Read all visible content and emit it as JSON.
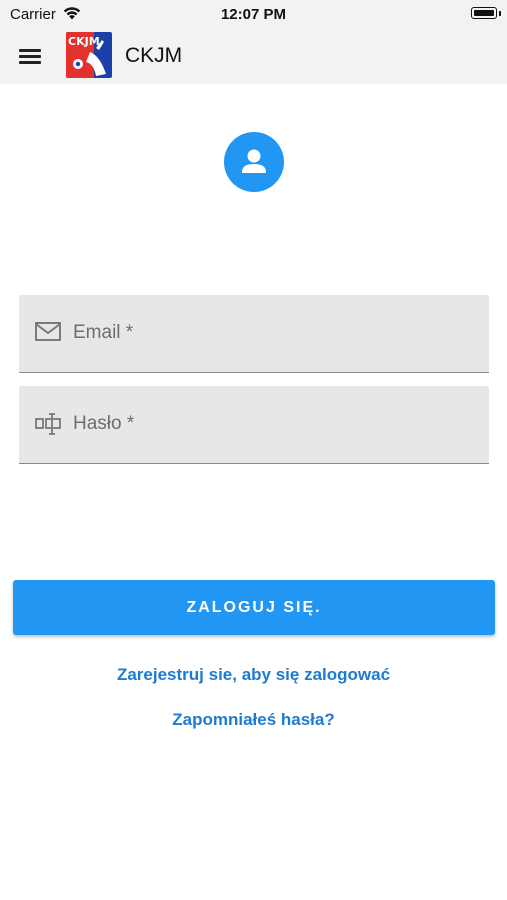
{
  "status_bar": {
    "carrier": "Carrier",
    "time": "12:07 PM"
  },
  "app_bar": {
    "title": "CKJM",
    "logo_text": "CKJM"
  },
  "form": {
    "email_placeholder": "Email *",
    "password_placeholder": "Hasło *",
    "login_label": "ZALOGUJ SIĘ.",
    "register_link": "Zarejestruj sie, aby się zalogować",
    "forgot_link": "Zapomniałeś hasła?"
  },
  "colors": {
    "primary": "#2196f3",
    "link": "#1e7bd1",
    "field_bg": "#e7e7e7",
    "bar_bg": "#f2f2f2"
  },
  "icons": [
    "wifi-icon",
    "battery-icon",
    "menu-icon",
    "logo",
    "user-icon",
    "envelope-icon",
    "password-field-icon"
  ]
}
